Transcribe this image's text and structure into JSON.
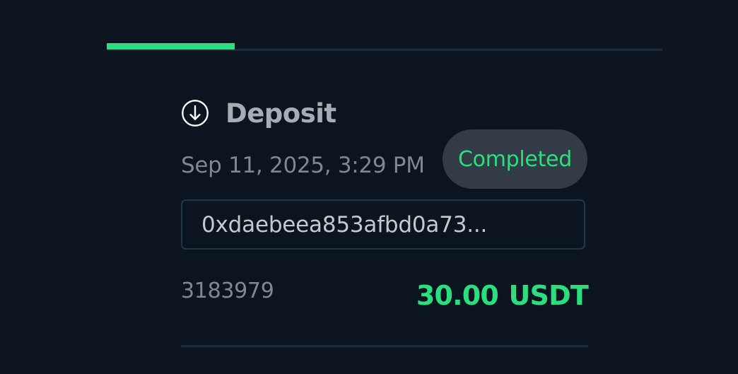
{
  "progress": {
    "fraction": 0.23,
    "fill_color": "#2bdf7f",
    "track_color": "#1c2a39"
  },
  "transaction": {
    "type_icon": "arrow-down-circle-icon",
    "type_label": "Deposit",
    "datetime": "Sep 11, 2025, 3:29 PM",
    "status": "Completed",
    "hash": "0xdaebeea853afbd0a73...",
    "id": "3183979",
    "amount": "30.00 USDT"
  },
  "colors": {
    "background": "#0a1520",
    "accent_green": "#2bdf7f",
    "badge_bg": "#313c46"
  }
}
